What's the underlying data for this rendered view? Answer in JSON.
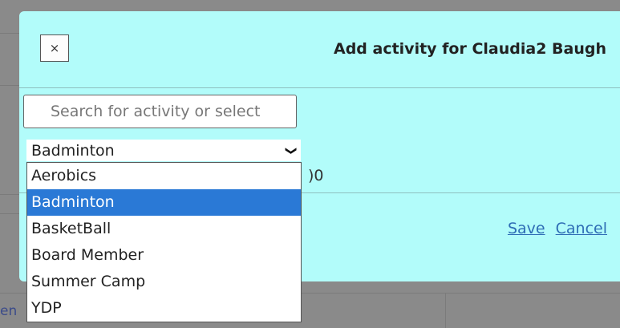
{
  "background": {
    "partial_link": "en"
  },
  "modal": {
    "close_label": "×",
    "title": "Add activity for Claudia2 Baugh",
    "search_placeholder": "Search for activity or select",
    "select_value": "Badminton",
    "partial_field_value": ")0",
    "save_label": "Save",
    "cancel_label": "Cancel"
  },
  "dropdown": {
    "options": [
      "Aerobics",
      "Badminton",
      "BasketBall",
      "Board Member",
      "Summer Camp",
      "YDP"
    ],
    "selected_index": 1
  },
  "colors": {
    "modal_bg": "#b2fcfa",
    "selected_bg": "#2a79d6",
    "link": "#2e6db5"
  }
}
